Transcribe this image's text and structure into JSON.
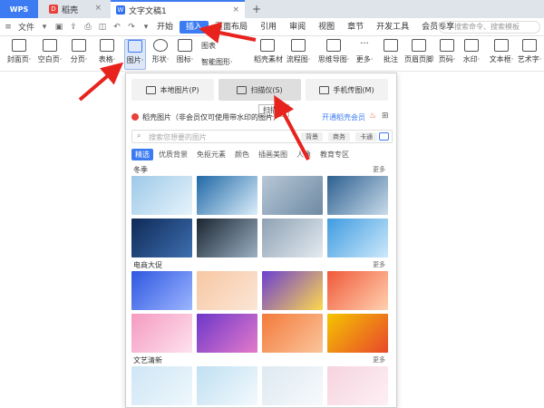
{
  "titlebar": {
    "app_tab": "WPS",
    "tabs": [
      {
        "label": "稻壳"
      },
      {
        "label": "文字文稿1"
      }
    ],
    "new_tab": "+"
  },
  "menubar": {
    "file_label": "文件",
    "tabs": [
      "开始",
      "插入",
      "页面布局",
      "引用",
      "审阅",
      "视图",
      "章节",
      "开发工具",
      "会员专享"
    ],
    "active_tab": "插入",
    "search_placeholder": "搜索命令、搜索模板"
  },
  "ribbon": {
    "buttons": [
      {
        "label": "封面页·"
      },
      {
        "label": "空白页·"
      },
      {
        "label": "分页·"
      },
      {
        "label": "表格·"
      },
      {
        "label": "图片·"
      },
      {
        "label": "形状·"
      },
      {
        "label": "图标·"
      },
      {
        "label": "图表"
      },
      {
        "label": "智能图形·"
      },
      {
        "label": "稻壳素材"
      },
      {
        "label": "流程图·"
      },
      {
        "label": "思维导图·"
      },
      {
        "label": "更多·"
      },
      {
        "label": "批注"
      },
      {
        "label": "页眉页脚"
      },
      {
        "label": "页码·"
      },
      {
        "label": "水印·"
      },
      {
        "label": "文本框·"
      },
      {
        "label": "艺术字·"
      }
    ]
  },
  "picture_panel": {
    "source_buttons": [
      "本地图片(P)",
      "扫描仪(S)",
      "手机传图(M)"
    ],
    "tooltip": "扫描仪",
    "promo_text": "稻壳图片（非会员仅可使用带水印的图片）",
    "promo_link": "开通稻壳会员",
    "search_placeholder": "搜索您想要的图片",
    "search_chips": [
      "背景",
      "商务",
      "卡通"
    ],
    "filters": [
      "精选",
      "优质背景",
      "免抠元素",
      "颜色",
      "插画美图",
      "人像",
      "教育专区"
    ],
    "active_filter": "精选",
    "sections": [
      {
        "title": "冬季",
        "more": "更多"
      },
      {
        "title": "电商大促",
        "more": "更多"
      },
      {
        "title": "文艺清新",
        "more": "更多"
      }
    ],
    "thumbnails": [
      {
        "name": "winter-frost",
        "colors": [
          "#9ec9e8",
          "#e6f3fb"
        ]
      },
      {
        "name": "winter-snowflake-frame",
        "colors": [
          "#1f68a6",
          "#dceefa"
        ]
      },
      {
        "name": "winter-snowy-trees",
        "colors": [
          "#b7c7d6",
          "#6e8aa3"
        ]
      },
      {
        "name": "winter-forest",
        "colors": [
          "#2d5f8f",
          "#c9dcea"
        ]
      },
      {
        "name": "winter-night-christmas-tree",
        "colors": [
          "#0e2a57",
          "#3e6fb0"
        ]
      },
      {
        "name": "winter-lantern",
        "colors": [
          "#1b2530",
          "#9ab0c4"
        ]
      },
      {
        "name": "winter-village",
        "colors": [
          "#8ea1b3",
          "#e4ebf1"
        ]
      },
      {
        "name": "winter-snowflakes-blue",
        "colors": [
          "#3f9be0",
          "#cde9fb"
        ]
      },
      {
        "name": "sale-blue-board",
        "colors": [
          "#2f57e0",
          "#9bb5ff"
        ]
      },
      {
        "name": "sale-peach-figures",
        "colors": [
          "#f7c7a3",
          "#fbe6d6"
        ]
      },
      {
        "name": "sale-green-circle",
        "colors": [
          "#6b3fd1",
          "#ffd84d"
        ]
      },
      {
        "name": "sale-orange-blob",
        "colors": [
          "#f05a3a",
          "#ffd1b0"
        ]
      },
      {
        "name": "sale-pink-shop",
        "colors": [
          "#f59ac0",
          "#fde2ee"
        ]
      },
      {
        "name": "sale-purple-stage",
        "colors": [
          "#6d37c9",
          "#e47acb"
        ]
      },
      {
        "name": "sale-orange-flowers",
        "colors": [
          "#f37a3b",
          "#fbc59b"
        ]
      },
      {
        "name": "sale-yellow-phone",
        "colors": [
          "#f5c400",
          "#e8472b"
        ]
      },
      {
        "name": "fresh-light-blue",
        "colors": [
          "#cfe6f5",
          "#eef7fc"
        ]
      },
      {
        "name": "fresh-ice",
        "colors": [
          "#bfe0f2",
          "#f3f9fd"
        ]
      },
      {
        "name": "fresh-pale-white",
        "colors": [
          "#dde9f1",
          "#f7fafc"
        ]
      },
      {
        "name": "fresh-pink-blossom",
        "colors": [
          "#f6d3df",
          "#fdf0f4"
        ]
      }
    ]
  },
  "colors": {
    "accent": "#3c7bf2",
    "arrow": "#e8221d"
  }
}
